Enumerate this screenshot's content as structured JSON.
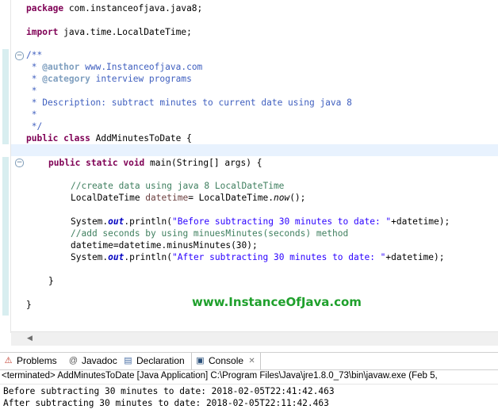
{
  "editor": {
    "line_package": "package com.instanceofjava.java8;",
    "pkg_kw": "package",
    "pkg_name": " com.instanceofjava.java8;",
    "imp_kw": "import",
    "imp_name": " java.time.LocalDateTime;",
    "jd_open": "/**",
    "jd_star": " * ",
    "jd_author_tag": "@author",
    "jd_author_val": " www.Instanceofjava.com",
    "jd_category_tag": "@category",
    "jd_category_val": " interview programs",
    "jd_empty": " *",
    "jd_desc": " * Description: subtract minutes to current date using java 8",
    "jd_close": " */",
    "class_kw1": "public",
    "class_kw2": "class",
    "class_name": " AddMinutesToDate {",
    "main_kw1": "public",
    "main_kw2": "static",
    "main_kw3": "void",
    "main_sig": " main(String[] args) {",
    "c1": "//create data using java 8 LocalDateTime",
    "l1_type": "LocalDateTime ",
    "l1_var": "datetime",
    "l1_mid": "= LocalDateTime.",
    "l1_now": "now",
    "l1_end": "();",
    "p1_sys": "System.",
    "p1_out": "out",
    "p1_call": ".println(",
    "p1_str": "\"Before subtracting 30 minutes to date: \"",
    "p1_end": "+datetime);",
    "c2": "//add seconds by using minuesMinutes(seconds) method",
    "l2": "datetime=datetime.minusMinutes(30);",
    "p2_sys": "System.",
    "p2_out": "out",
    "p2_call": ".println(",
    "p2_str": "\"After subtracting 30 minutes to date: \"",
    "p2_end": "+datetime);",
    "close_inner": "}",
    "close_outer": "}"
  },
  "watermark": "www.InstanceOfJava.com",
  "tabs": [
    {
      "label": "Problems",
      "icon": "problems-icon"
    },
    {
      "label": "Javadoc",
      "icon": "javadoc-icon"
    },
    {
      "label": "Declaration",
      "icon": "declaration-icon"
    },
    {
      "label": "Console",
      "icon": "console-icon"
    }
  ],
  "console": {
    "header": "<terminated> AddMinutesToDate [Java Application] C:\\Program Files\\Java\\jre1.8.0_73\\bin\\javaw.exe (Feb 5,",
    "output1": "Before subtracting 30 minutes to date: 2018-02-05T22:41:42.463",
    "output2": "After subtracting 30 minutes to date: 2018-02-05T22:11:42.463"
  }
}
